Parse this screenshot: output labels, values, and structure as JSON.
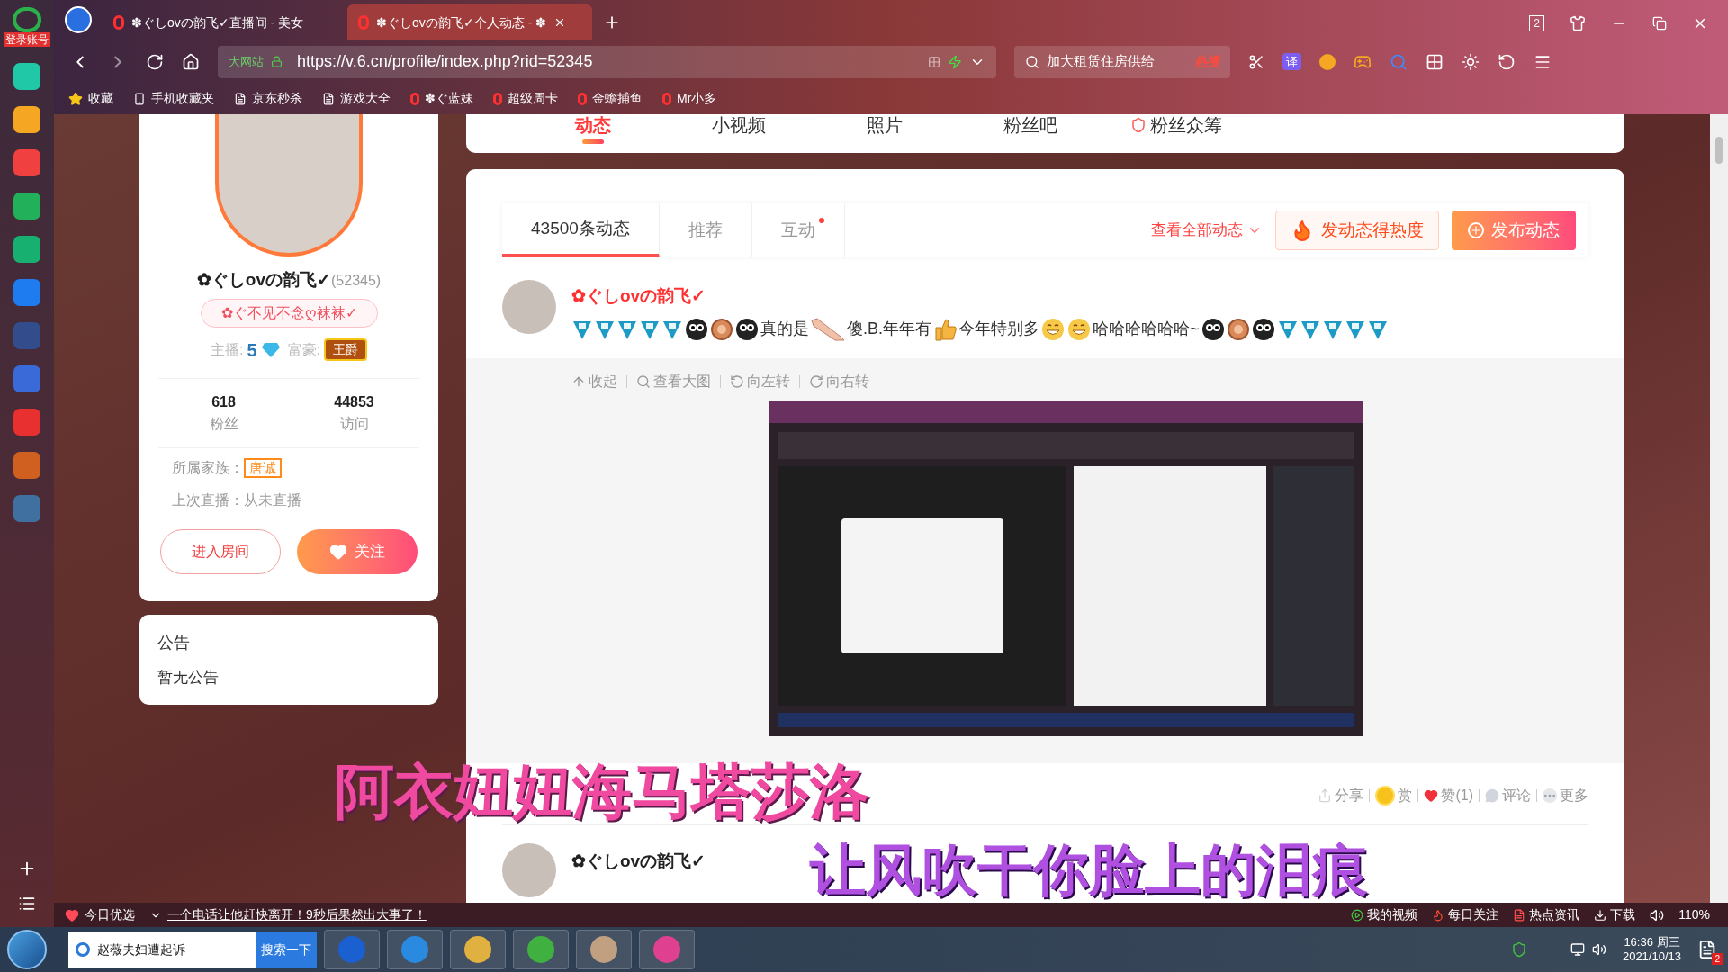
{
  "app_sidebar": {
    "login_label": "登录账号"
  },
  "browser": {
    "tabs": [
      {
        "title": "✽ぐしovの韵飞✓直播间 - 美女",
        "selected": false
      },
      {
        "title": "✽ぐしovの韵飞✓个人动态 - ✽",
        "selected": true
      }
    ],
    "window_badge": "2",
    "address": {
      "prefix": "大网站",
      "url": "https://v.6.cn/profile/index.php?rid=52345"
    },
    "search": {
      "placeholder": "加大租赁住房供给",
      "hot": "热搜"
    },
    "translate": "译",
    "bookmarks": [
      "收藏",
      "手机收藏夹",
      "京东秒杀",
      "游戏大全",
      "✽ぐ蓝妹",
      "超级周卡",
      "金蟾捕鱼",
      "Mr小多"
    ]
  },
  "profile": {
    "name": "✿ぐしovの韵飞✓",
    "id": "(52345)",
    "signature": "✿ぐ不见不念ღ袜袜✓",
    "anchor_label": "主播:",
    "anchor_level": "5",
    "rich_label": "富豪:",
    "rich_badge": "王爵",
    "stats": [
      {
        "value": "618",
        "label": "粉丝"
      },
      {
        "value": "44853",
        "label": "访问"
      }
    ],
    "info": [
      {
        "label": "所属家族：",
        "value": "唐诚",
        "kind": "badge"
      },
      {
        "label": "上次直播：",
        "value": "从未直播",
        "kind": "text"
      }
    ],
    "enter_button": "进入房间",
    "follow_button": "关注"
  },
  "announcement": {
    "title": "公告",
    "text": "暂无公告"
  },
  "nav_tabs": [
    {
      "label": "动态",
      "selected": true,
      "kind": "plain"
    },
    {
      "label": "小视频",
      "selected": false,
      "kind": "plain"
    },
    {
      "label": "照片",
      "selected": false,
      "kind": "plain"
    },
    {
      "label": "粉丝吧",
      "selected": false,
      "kind": "plain"
    },
    {
      "label": "粉丝众筹",
      "selected": false,
      "kind": "shield"
    }
  ],
  "feed": {
    "tabs": [
      {
        "label": "43500条动态",
        "selected": true,
        "dot": false
      },
      {
        "label": "推荐",
        "selected": false,
        "dot": false
      },
      {
        "label": "互动",
        "selected": false,
        "dot": true
      }
    ],
    "view_all": "查看全部动态",
    "hot_button": "发动态得热度",
    "publish_button": "发布动态",
    "posts": [
      {
        "author": "✿ぐしovの韵飞✓",
        "highlight": true,
        "content": [
          {
            "kind": "five"
          },
          {
            "kind": "five"
          },
          {
            "kind": "five"
          },
          {
            "kind": "five"
          },
          {
            "kind": "five"
          },
          {
            "kind": "panda"
          },
          {
            "kind": "coin"
          },
          {
            "kind": "panda"
          },
          {
            "kind": "text",
            "text": "真的是"
          },
          {
            "kind": "leg"
          },
          {
            "kind": "text",
            "text": "傻.B.年年有"
          },
          {
            "kind": "thumb"
          },
          {
            "kind": "text",
            "text": "今年特别多"
          },
          {
            "kind": "grin"
          },
          {
            "kind": "grin"
          },
          {
            "kind": "text",
            "text": "哈哈哈哈哈哈~"
          },
          {
            "kind": "panda"
          },
          {
            "kind": "coin"
          },
          {
            "kind": "panda"
          },
          {
            "kind": "five"
          },
          {
            "kind": "five"
          },
          {
            "kind": "five"
          },
          {
            "kind": "five"
          },
          {
            "kind": "five"
          }
        ],
        "tools": [
          "收起",
          "查看大图",
          "向左转",
          "向右转"
        ],
        "actions": [
          {
            "kind": "share",
            "label": "分享"
          },
          {
            "kind": "reward",
            "label": "赏"
          },
          {
            "kind": "like",
            "label": "赞(1)"
          },
          {
            "kind": "comment",
            "label": "评论"
          },
          {
            "kind": "more",
            "label": "更多"
          }
        ]
      },
      {
        "author": "✿ぐしovの韵飞✓",
        "highlight": false
      }
    ]
  },
  "lyrics": [
    "阿衣妞妞海马塔莎洛",
    "让风吹干你脸上的泪痕"
  ],
  "status_bar": {
    "left": "今日优选",
    "news": "一个电话让他赶快离开！9秒后果然出大事了！",
    "right": [
      "我的视频",
      "每日关注",
      "热点资讯",
      "下载"
    ],
    "zoom": "110%"
  },
  "taskbar": {
    "search": "赵薇夫妇遭起诉",
    "search_button": "搜索一下",
    "time": "16:36 周三",
    "date": "2021/10/13",
    "badge": "2"
  }
}
